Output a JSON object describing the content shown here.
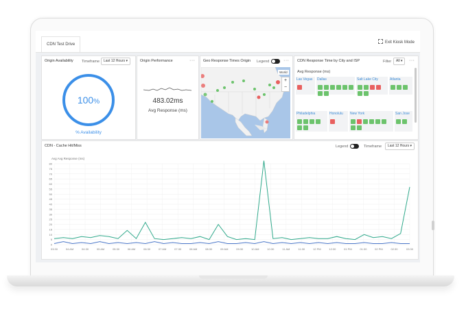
{
  "topbar": {
    "tab_label": "CDN Test Drive",
    "kiosk_label": "Exit Kiosk Mode"
  },
  "availability": {
    "title": "Origin Availability",
    "timeframe_label": "Timeframe",
    "timeframe_value": "Last 12 Hours",
    "value": "100",
    "unit": "%",
    "caption": "% Availability",
    "ring_color": "#3b8fe8"
  },
  "performance": {
    "title": "Origin Performance",
    "value": "483.02ms",
    "caption": "Avg Response (ms)"
  },
  "geo": {
    "title": "Geo Response Times Origin",
    "legend_label": "Legend",
    "world_label": "World",
    "zoom_in": "+",
    "zoom_out": "−"
  },
  "city_panel": {
    "title": "CDN Response Time by City and ISP",
    "filter_label": "Filter",
    "filter_value": "All",
    "subtitle": "Avg Response (ms)",
    "cities": [
      {
        "name": "Las Vegas",
        "cells": [
          "r"
        ]
      },
      {
        "name": "Dallas",
        "cells": [
          "g",
          "g",
          "g",
          "g",
          "g",
          "g",
          "g",
          "g"
        ]
      },
      {
        "name": "Salt Lake City",
        "cells": [
          "g",
          "g",
          "r",
          "r",
          "g",
          "g"
        ]
      },
      {
        "name": "Atlanta",
        "cells": [
          "g",
          "g",
          "g"
        ]
      },
      {
        "name": "Philadelphia",
        "cells": [
          "g",
          "g",
          "g",
          "g",
          "g",
          "g"
        ]
      },
      {
        "name": "Honolulu",
        "cells": [
          "r"
        ]
      },
      {
        "name": "New York",
        "cells": [
          "g",
          "r",
          "g",
          "g",
          "g",
          "g",
          "g",
          "g"
        ]
      },
      {
        "name": "San Jose",
        "cells": [
          "g",
          "g"
        ]
      }
    ]
  },
  "cache": {
    "title": "CDN - Cache Hit/Miss",
    "legend_label": "Legend",
    "timeframe_label": "Timeframe",
    "timeframe_value": "Last 12 Hours",
    "series_label": "Avg Avg Response (ms)"
  },
  "colors": {
    "green": "#6cc36c",
    "red": "#e8605f",
    "teal": "#2ea88a",
    "blue": "#4a76c8"
  },
  "chart_data": {
    "type": "line",
    "ylabel": "Avg Avg Response (ms)",
    "ylim": [
      0,
      80
    ],
    "yticks": [
      0,
      5,
      10,
      15,
      20,
      25,
      30,
      35,
      40,
      45,
      50,
      55,
      60,
      65,
      70,
      75,
      80
    ],
    "x": [
      "03:30",
      "04:00",
      "04:30",
      "05:00",
      "05:30",
      "06:00",
      "06:30",
      "07:00",
      "07:30",
      "08:00",
      "08:30",
      "09:00",
      "09:30",
      "10:00",
      "10:30",
      "11:00",
      "11:30",
      "12:00",
      "12:30",
      "01:00",
      "01:30",
      "02:00",
      "02:30",
      "03:00"
    ],
    "xticks": [
      "03:30",
      "04 AM",
      "04:30",
      "05 AM",
      "05:30",
      "06 AM",
      "06:30",
      "07 AM",
      "07:30",
      "08 AM",
      "08:30",
      "09 AM",
      "09:30",
      "10 AM",
      "10:30",
      "11 AM",
      "11:30",
      "12 PM",
      "12:30",
      "01 PM",
      "01:30",
      "02 PM",
      "02:30",
      "03:30"
    ],
    "series": [
      {
        "color": "#2ea88a",
        "values": [
          6,
          7,
          6,
          8,
          7,
          9,
          8,
          6,
          14,
          6,
          22,
          6,
          5,
          6,
          7,
          6,
          8,
          5,
          20,
          8,
          5,
          6,
          5,
          83,
          6,
          7,
          5,
          6,
          7,
          6,
          6,
          8,
          6,
          5,
          10,
          7,
          8,
          6,
          11,
          57
        ]
      },
      {
        "color": "#4a76c8",
        "values": [
          1,
          3,
          1,
          2,
          1,
          3,
          1,
          2,
          1,
          2,
          1,
          3,
          1,
          2,
          1,
          1,
          2,
          1,
          3,
          1,
          1,
          2,
          1,
          3,
          1,
          2,
          1,
          2,
          1,
          2,
          1,
          2,
          1,
          1,
          2,
          1,
          1,
          2,
          1,
          1
        ]
      }
    ]
  }
}
